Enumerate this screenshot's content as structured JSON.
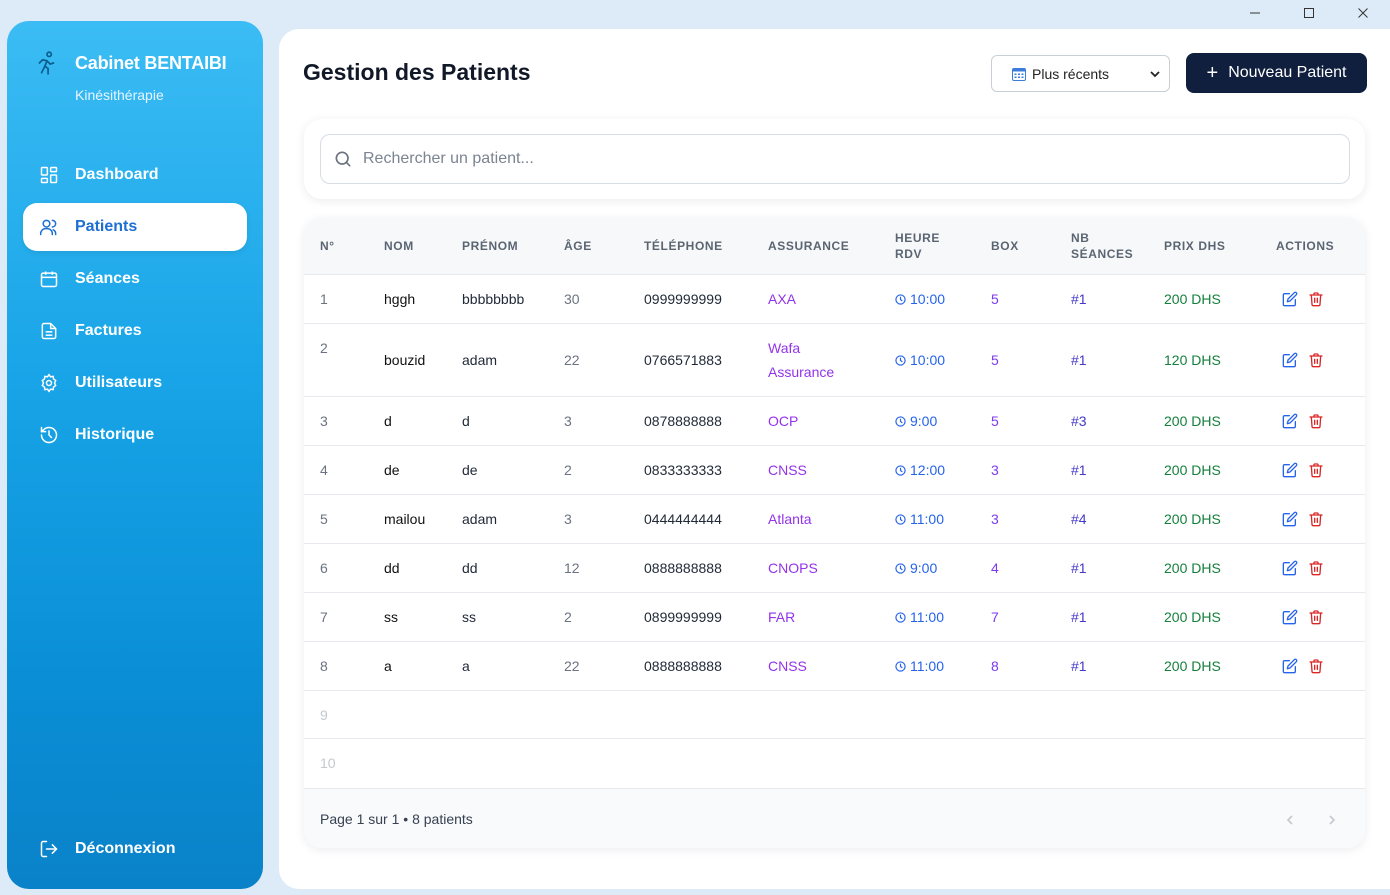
{
  "brand": {
    "title": "Cabinet BENTAIBI",
    "subtitle": "Kinésithérapie",
    "icon": "running-person-icon"
  },
  "sidebar": {
    "items": [
      {
        "label": "Dashboard",
        "icon": "dashboard-icon"
      },
      {
        "label": "Patients",
        "icon": "users-icon",
        "active": true
      },
      {
        "label": "Séances",
        "icon": "calendar-icon"
      },
      {
        "label": "Factures",
        "icon": "file-icon"
      },
      {
        "label": "Utilisateurs",
        "icon": "gear-icon"
      },
      {
        "label": "Historique",
        "icon": "history-icon"
      }
    ],
    "logout": "Déconnexion"
  },
  "header": {
    "title": "Gestion des Patients",
    "sort_selected": "Plus récents",
    "new_button": "Nouveau Patient"
  },
  "search": {
    "placeholder": "Rechercher un patient..."
  },
  "table": {
    "columns": [
      "N°",
      "NOM",
      "PRÉNOM",
      "ÂGE",
      "TÉLÉPHONE",
      "ASSURANCE",
      "HEURE RDV",
      "BOX",
      "NB SÉANCES",
      "PRIX DHS",
      "ACTIONS"
    ],
    "rows": [
      {
        "n": "1",
        "nom": "hggh",
        "prenom": "bbbbbbbb",
        "age": "30",
        "tel": "0999999999",
        "assurance": "AXA",
        "heure": "10:00",
        "box": "5",
        "seances": "#1",
        "prix": "200 DHS"
      },
      {
        "n": "2",
        "nom": "bouzid",
        "prenom": "adam",
        "age": "22",
        "tel": "0766571883",
        "assurance": "Wafa Assurance",
        "heure": "10:00",
        "box": "5",
        "seances": "#1",
        "prix": "120 DHS"
      },
      {
        "n": "3",
        "nom": "d",
        "prenom": "d",
        "age": "3",
        "tel": "0878888888",
        "assurance": "OCP",
        "heure": "9:00",
        "box": "5",
        "seances": "#3",
        "prix": "200 DHS"
      },
      {
        "n": "4",
        "nom": "de",
        "prenom": "de",
        "age": "2",
        "tel": "0833333333",
        "assurance": "CNSS",
        "heure": "12:00",
        "box": "3",
        "seances": "#1",
        "prix": "200 DHS"
      },
      {
        "n": "5",
        "nom": "mailou",
        "prenom": "adam",
        "age": "3",
        "tel": "0444444444",
        "assurance": "Atlanta",
        "heure": "11:00",
        "box": "3",
        "seances": "#4",
        "prix": "200 DHS"
      },
      {
        "n": "6",
        "nom": "dd",
        "prenom": "dd",
        "age": "12",
        "tel": "0888888888",
        "assurance": "CNOPS",
        "heure": "9:00",
        "box": "4",
        "seances": "#1",
        "prix": "200 DHS"
      },
      {
        "n": "7",
        "nom": "ss",
        "prenom": "ss",
        "age": "2",
        "tel": "0899999999",
        "assurance": "FAR",
        "heure": "11:00",
        "box": "7",
        "seances": "#1",
        "prix": "200 DHS"
      },
      {
        "n": "8",
        "nom": "a",
        "prenom": "a",
        "age": "22",
        "tel": "0888888888",
        "assurance": "CNSS",
        "heure": "11:00",
        "box": "8",
        "seances": "#1",
        "prix": "200 DHS"
      }
    ],
    "empty_rows": [
      "9",
      "10"
    ]
  },
  "footer": {
    "info": "Page 1 sur 1 • 8 patients"
  },
  "colors": {
    "accent": "#1d6fd1",
    "sidebar": "#19a5e8",
    "button": "#0f1f3d",
    "insurance": "#9333ea",
    "price": "#15803d"
  }
}
